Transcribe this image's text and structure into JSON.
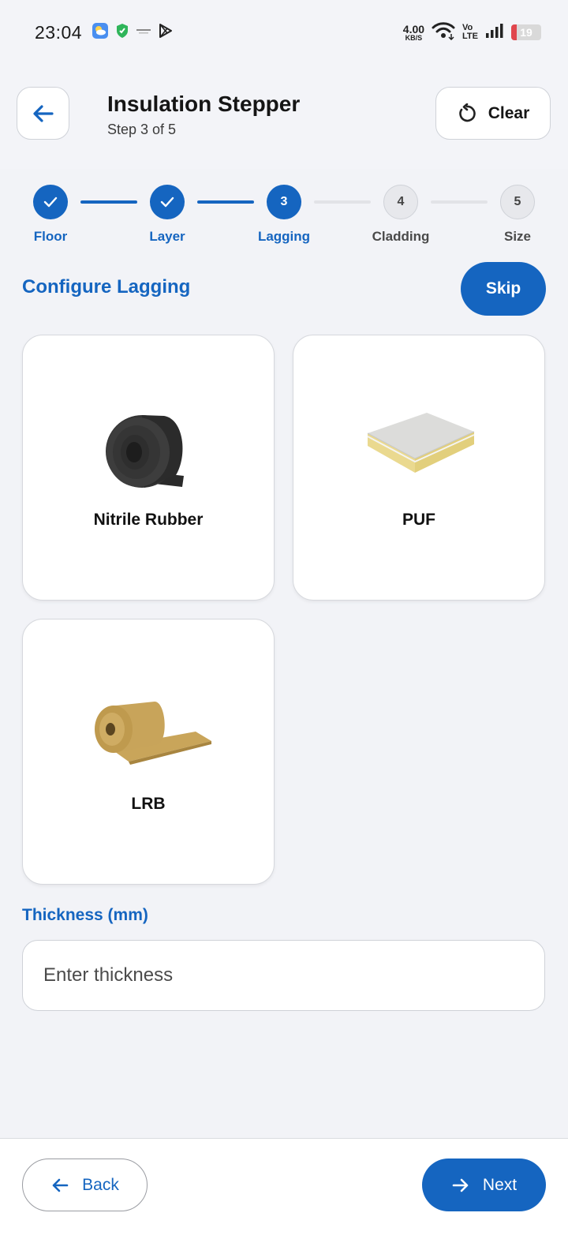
{
  "status_bar": {
    "time": "23:04",
    "net_speed_value": "4.00",
    "net_speed_unit": "KB/S",
    "volte_top": "Vo",
    "volte_bottom": "LTE",
    "battery": "19",
    "battery_level": 0.19,
    "battery_color": "#e0464d"
  },
  "header": {
    "title": "Insulation Stepper",
    "subtitle": "Step 3 of 5",
    "clear_label": "Clear"
  },
  "stepper": {
    "current": 3,
    "steps": [
      {
        "number": "1",
        "label": "Floor",
        "state": "done"
      },
      {
        "number": "2",
        "label": "Layer",
        "state": "done"
      },
      {
        "number": "3",
        "label": "Lagging",
        "state": "active"
      },
      {
        "number": "4",
        "label": "Cladding",
        "state": "pending"
      },
      {
        "number": "5",
        "label": "Size",
        "state": "pending"
      }
    ]
  },
  "section": {
    "title": "Configure Lagging",
    "skip_label": "Skip"
  },
  "options": [
    {
      "name": "Nitrile Rubber",
      "icon": "rubber-roll-image"
    },
    {
      "name": "PUF",
      "icon": "puf-panel-image"
    },
    {
      "name": "LRB",
      "icon": "lrb-roll-image"
    }
  ],
  "thickness": {
    "label": "Thickness (mm)",
    "placeholder": "Enter thickness",
    "value": ""
  },
  "footer": {
    "back_label": "Back",
    "next_label": "Next"
  },
  "colors": {
    "accent": "#1565c0",
    "background": "#f3f4f8"
  }
}
